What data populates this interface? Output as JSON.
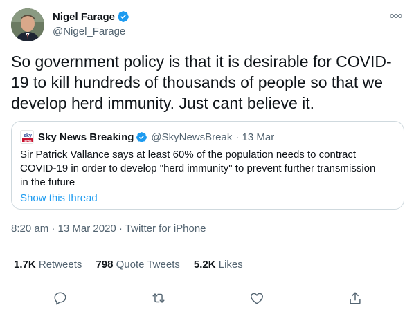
{
  "tweet": {
    "display_name": "Nigel Farage",
    "handle": "@Nigel_Farage",
    "text": "So government policy is that it is desirable for COVID-19 to kill hundreds of thousands of people so that we develop herd immunity. Just cant believe it.",
    "timestamp": "8:20 am · 13 Mar 2020 · Twitter for iPhone",
    "verified_icon": "verified-badge-icon",
    "more_icon": "more-options-icon"
  },
  "quote": {
    "logo_text": "sky news",
    "display_name": "Sky News Breaking",
    "handle": "@SkyNewsBreak",
    "date": "· 13 Mar",
    "text": "Sir Patrick Vallance says at least 60% of the population needs to contract COVID-19 in order to develop \"herd immunity\" to prevent further transmission in the future",
    "show_thread": "Show this thread"
  },
  "stats": {
    "retweets_count": "1.7K",
    "retweets_label": "Retweets",
    "quotes_count": "798",
    "quotes_label": "Quote Tweets",
    "likes_count": "5.2K",
    "likes_label": "Likes"
  },
  "actions": [
    "reply-icon",
    "retweet-icon",
    "like-icon",
    "share-icon"
  ],
  "colors": {
    "accent": "#1d9bf0",
    "text": "#0f1419",
    "secondary": "#536471",
    "border": "#cfd9de"
  }
}
